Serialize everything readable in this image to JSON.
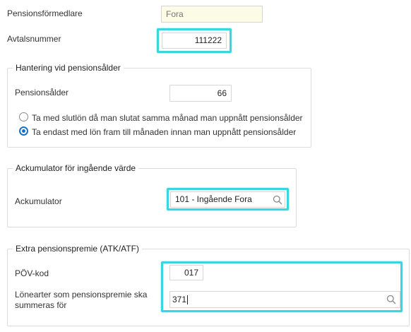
{
  "pension_broker": {
    "label": "Pensionsförmedlare",
    "value": "Fora"
  },
  "agreement_number": {
    "label": "Avtalsnummer",
    "value": "111222"
  },
  "retirement_section": {
    "legend": "Hantering vid pensionsålder",
    "age_label": "Pensionsålder",
    "age_value": "66",
    "options": [
      {
        "label": "Ta med slutlön då man slutat samma månad man uppnått pensionsålder",
        "selected": false
      },
      {
        "label": "Ta endast med lön fram till månaden innan man uppnått pensionsålder",
        "selected": true
      }
    ]
  },
  "accumulator_section": {
    "legend": "Ackumulator för ingående värde",
    "label": "Ackumulator",
    "value": "101 - Ingående Fora"
  },
  "extra_premium_section": {
    "legend": "Extra pensionspremie (ATK/ATF)",
    "pov_label": "PÖV-kod",
    "pov_value": "017",
    "wage_types_label_line1": "Lönearter som pensionspremie ska",
    "wage_types_label_line2": "summeras för",
    "wage_types_value": "371"
  },
  "colors": {
    "highlight": "#3ad6e0",
    "radio_accent": "#1a73c9",
    "readonly_bg": "#fbfbe6"
  }
}
